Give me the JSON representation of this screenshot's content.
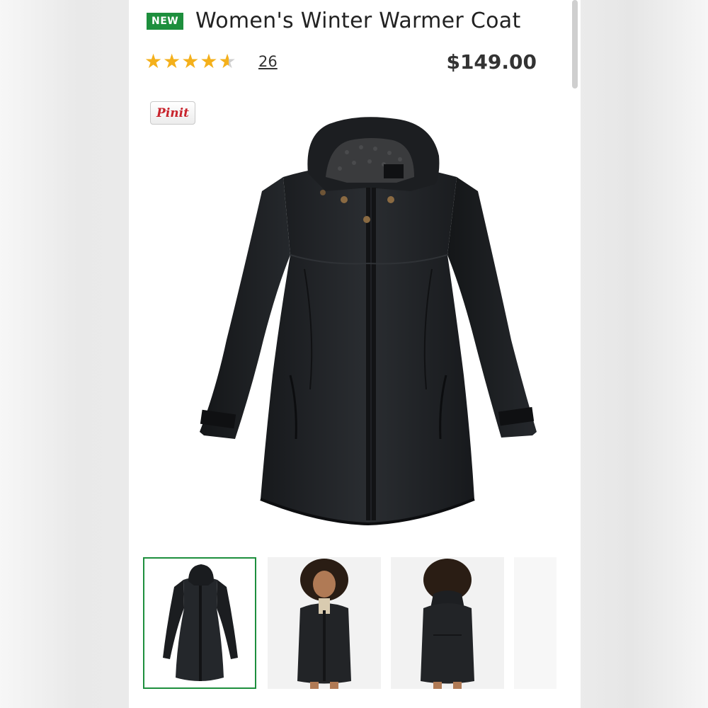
{
  "product": {
    "badge": "NEW",
    "title": "Women's Winter Warmer Coat",
    "rating_value": 4.5,
    "rating_max": 5,
    "review_count": "26",
    "price": "$149.00"
  },
  "pinit": {
    "label": "Pinit"
  },
  "main_image": {
    "alt": "black hooded parka coat"
  },
  "thumbnails": [
    {
      "name": "thumbnail-coat-flat",
      "selected": true
    },
    {
      "name": "thumbnail-model-front",
      "selected": false
    },
    {
      "name": "thumbnail-model-back",
      "selected": false
    },
    {
      "name": "thumbnail-partial",
      "selected": false
    }
  ],
  "colors": {
    "badge_green": "#1d8f3d",
    "star_gold": "#f4b01b",
    "pinit_red": "#c8232c",
    "coat_black": "#1e2023"
  }
}
